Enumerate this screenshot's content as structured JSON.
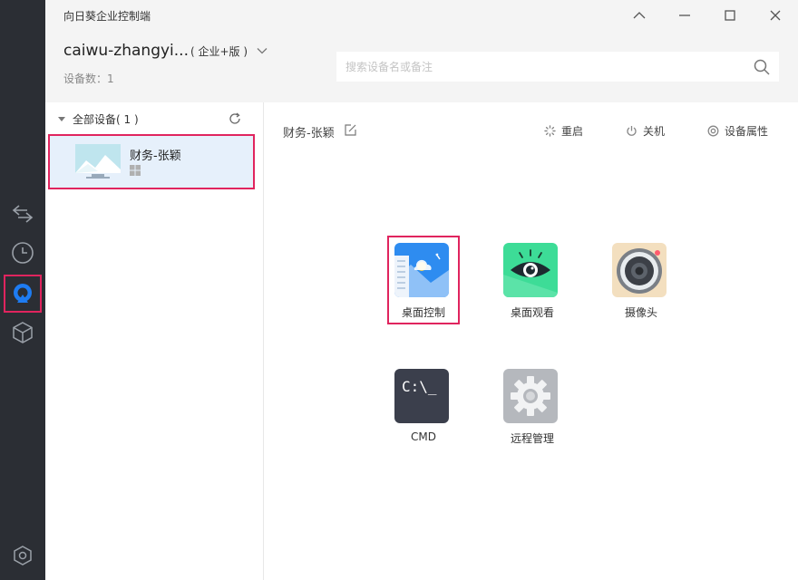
{
  "window": {
    "title": "向日葵企业控制端"
  },
  "account": {
    "name": "caiwu-zhangyi...",
    "edition": "( 企业+版 )",
    "device_count": "设备数：1"
  },
  "search": {
    "placeholder": "搜索设备名或备注"
  },
  "device_list": {
    "group_label": "全部设备( 1 )",
    "items": [
      {
        "name": "财务-张颖",
        "os": "windows-icon"
      }
    ]
  },
  "content": {
    "current_device": "财务-张颖",
    "actions": [
      {
        "label": "重启",
        "icon": "restart-icon"
      },
      {
        "label": "关机",
        "icon": "power-icon"
      },
      {
        "label": "设备属性",
        "icon": "settings-icon"
      }
    ],
    "tiles": [
      {
        "label": "桌面控制",
        "icon": "remote-desktop-icon"
      },
      {
        "label": "桌面观看",
        "icon": "eye-icon"
      },
      {
        "label": "摄像头",
        "icon": "camera-icon"
      },
      {
        "label": "CMD",
        "icon": "terminal-icon"
      },
      {
        "label": "远程管理",
        "icon": "gear-icon"
      }
    ],
    "cmd_glyph": "C:\\_"
  },
  "colors": {
    "rail": "#2b2e34",
    "header": "#f4f4f4",
    "selected_item": "#e6f0fb",
    "highlight_border": "#e0245e",
    "brand_blue": "#1e7cf2"
  }
}
